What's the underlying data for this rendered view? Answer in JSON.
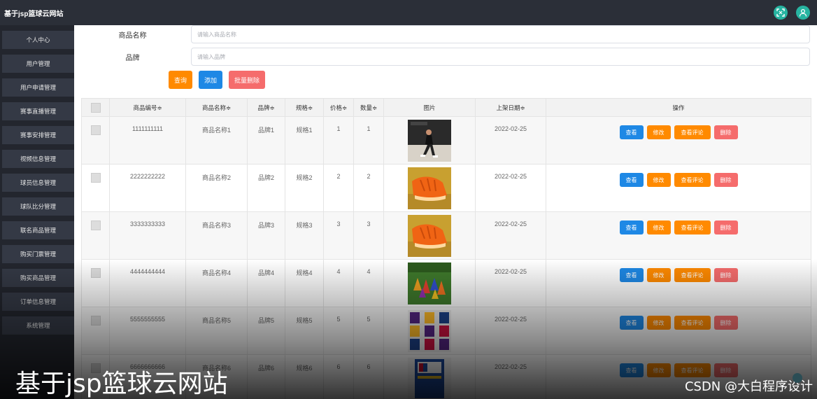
{
  "app": {
    "title": "基于jsp篮球云网站",
    "colors": {
      "topbar": "#2b2f38",
      "sidebar": "#23262e",
      "accent_teal": "#27b4a1",
      "primary": "#1e88e5",
      "warning": "#ff8a00",
      "danger": "#f56c6c"
    }
  },
  "header": {
    "icons": [
      "fullscreen-icon",
      "user-avatar-icon"
    ]
  },
  "sidebar": {
    "items": [
      {
        "label": "个人中心"
      },
      {
        "label": "用户管理"
      },
      {
        "label": "用户申请管理"
      },
      {
        "label": "赛事直播管理"
      },
      {
        "label": "赛事安排管理"
      },
      {
        "label": "视频信息管理"
      },
      {
        "label": "球员信息管理"
      },
      {
        "label": "球队比分管理"
      },
      {
        "label": "联名商品管理"
      },
      {
        "label": "购买门票管理"
      },
      {
        "label": "购买商品管理"
      },
      {
        "label": "订单信息管理"
      },
      {
        "label": "系统管理"
      }
    ]
  },
  "search": {
    "name_label": "商品名称",
    "name_placeholder": "请输入商品名称",
    "brand_label": "品牌",
    "brand_placeholder": "请输入品牌",
    "query_label": "查询",
    "add_label": "添加",
    "batch_delete_label": "批量删除"
  },
  "table": {
    "headers": {
      "code": "商品编号≑",
      "name": "商品名称≑",
      "brand": "品牌≑",
      "spec": "规格≑",
      "price": "价格≑",
      "qty": "数量≑",
      "pic": "图片",
      "date": "上架日期≑",
      "ops": "操作"
    },
    "action_labels": {
      "view": "查看",
      "edit": "修改",
      "review": "查看评论",
      "delete": "删除"
    },
    "rows": [
      {
        "code": "1111111111",
        "name": "商品名称1",
        "brand": "品牌1",
        "spec": "规格1",
        "price": "1",
        "qty": "1",
        "image": "training-player-photo",
        "date": "2022-02-25"
      },
      {
        "code": "2222222222",
        "name": "商品名称2",
        "brand": "品牌2",
        "spec": "规格2",
        "price": "2",
        "qty": "2",
        "image": "orange-sneaker-photo",
        "date": "2022-02-25"
      },
      {
        "code": "3333333333",
        "name": "商品名称3",
        "brand": "品牌3",
        "spec": "规格3",
        "price": "3",
        "qty": "3",
        "image": "orange-sneaker-photo",
        "date": "2022-02-25"
      },
      {
        "code": "4444444444",
        "name": "商品名称4",
        "brand": "品牌4",
        "spec": "规格4",
        "price": "4",
        "qty": "4",
        "image": "training-cones-photo",
        "date": "2022-02-25"
      },
      {
        "code": "5555555555",
        "name": "商品名称5",
        "brand": "品牌5",
        "spec": "规格5",
        "price": "5",
        "qty": "5",
        "image": "jerseys-photo",
        "date": "2022-02-25"
      },
      {
        "code": "6666666666",
        "name": "商品名称6",
        "brand": "品牌6",
        "spec": "规格6",
        "price": "6",
        "qty": "6",
        "image": "nba-book-cover",
        "date": "2022-02-25"
      }
    ]
  },
  "overlay": {
    "title": "基于jsp篮球云网站",
    "watermark": "CSDN @大白程序设计"
  }
}
